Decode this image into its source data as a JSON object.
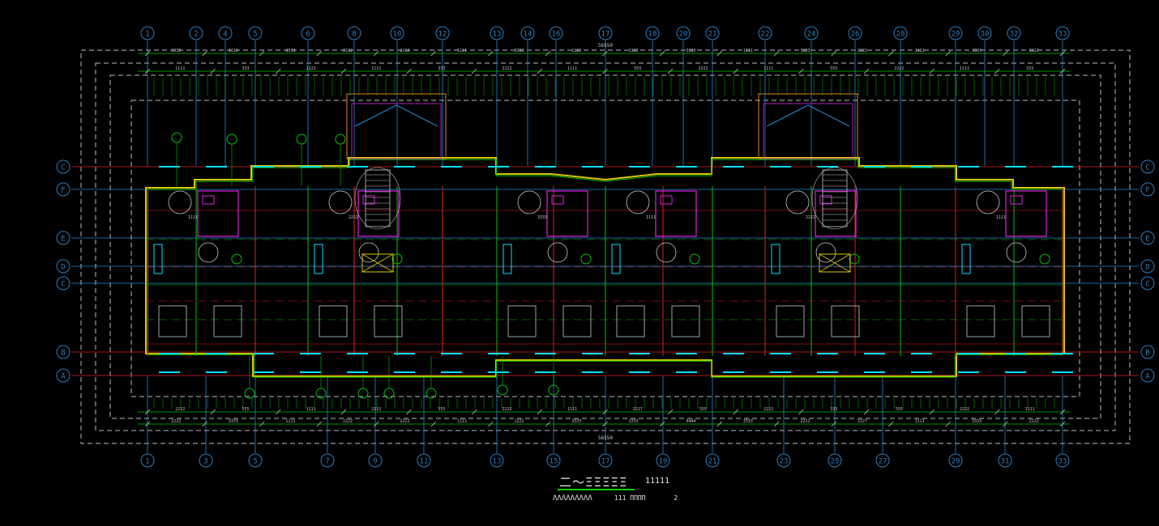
{
  "drawing": {
    "colors": {
      "background": "#000000",
      "axis": "#1e8bd6",
      "axis_bubble": "#2a7fbf",
      "grid_red": "#e02020",
      "wall_green": "#00c400",
      "wall_yellow": "#d8c800",
      "fixture_magenta": "#e020e0",
      "window_cyan": "#00e0ff",
      "dim_white": "#c8c8c8",
      "balcony_orange": "#e08020",
      "dash_white": "#bbbbbb"
    },
    "top_axes": [
      "1",
      "2",
      "4",
      "5",
      "6",
      "8",
      "10",
      "12",
      "13",
      "14",
      "16",
      "17",
      "18",
      "20",
      "21",
      "22",
      "24",
      "26",
      "28",
      "29",
      "30",
      "32",
      "33"
    ],
    "bottom_axes": [
      "1",
      "3",
      "5",
      "7",
      "9",
      "11",
      "13",
      "15",
      "17",
      "19",
      "21",
      "23",
      "25",
      "27",
      "29",
      "31",
      "33"
    ],
    "left_axes": [
      "C",
      "F",
      "E",
      "D",
      "C",
      "B",
      "A"
    ],
    "right_axes": [
      "C",
      "F",
      "E",
      "D",
      "C",
      "B",
      "A"
    ],
    "overall_dim_top": "56550",
    "overall_dim_bottom": "56550",
    "top_segment_dims": [
      "3333",
      "1111",
      "3333",
      "2222",
      "2222",
      "1111",
      "3333",
      "2222",
      "2222",
      "3333",
      "1111",
      "3333",
      "2222",
      "1111",
      "3333",
      "2222"
    ],
    "bottom_segment_dims": [
      "2222",
      "3333",
      "1111",
      "2222",
      "2222",
      "1111",
      "2222",
      "3333",
      "3333",
      "4444",
      "3333",
      "2222",
      "2227",
      "1111",
      "3333",
      "2222"
    ],
    "top_detail_dims": [
      "1111",
      "333",
      "2222",
      "1111",
      "333",
      "2222",
      "1111",
      "555",
      "2222",
      "1111",
      "555",
      "2222",
      "1111",
      "333"
    ],
    "bottom_detail_dims": [
      "2222",
      "555",
      "1111",
      "2222",
      "555",
      "2222",
      "1111",
      "2227",
      "555",
      "2222",
      "333",
      "555",
      "2222",
      "1111"
    ],
    "room_labels": [
      "1111",
      "2222",
      "3333",
      "1111",
      "2222"
    ],
    "title": {
      "main": "二～ΞΞΞΞΞ",
      "scale": "11111",
      "sub": "ΛΛΛΛΛΛΛΛΛ",
      "note_code": "111",
      "note_text": "ΠΠΠΠ",
      "note_small": "2"
    }
  }
}
